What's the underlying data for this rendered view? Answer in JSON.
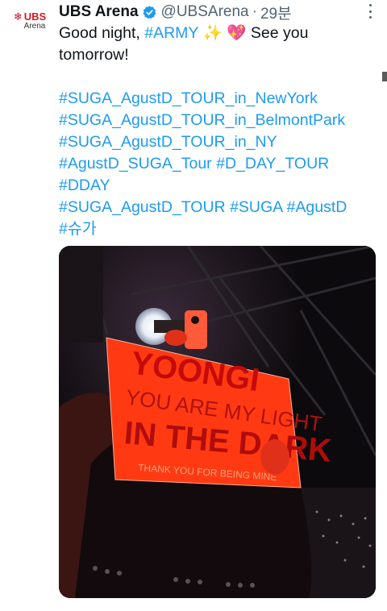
{
  "account": {
    "avatar_brand": "UBS",
    "avatar_sub": "Arena",
    "name": "UBS Arena",
    "handle": "@UBSArena",
    "separator": "·",
    "time": "29분"
  },
  "tweet": {
    "line1": {
      "text": "Good night, ",
      "hashtag": "#ARMY",
      "emoji": " ✨ 💖",
      "tail": " See you"
    },
    "line2": "tomorrow!",
    "hashtag_lines": [
      [
        "#SUGA_AgustD_TOUR_in_NewYork"
      ],
      [
        "#SUGA_AgustD_TOUR_in_BelmontPark"
      ],
      [
        "#SUGA_AgustD_TOUR_in_NY"
      ],
      [
        "#AgustD_SUGA_Tour",
        "#D_DAY_TOUR"
      ],
      [
        "#DDAY"
      ],
      [
        "#SUGA_AgustD_TOUR",
        "#SUGA",
        "#AgustD"
      ],
      [
        "#슈가"
      ]
    ]
  },
  "photo": {
    "sign_lines": [
      "YOONGI",
      "YOU ARE MY LIGHT",
      "IN THE DARK",
      "THANK YOU FOR BEING MINE"
    ]
  },
  "colors": {
    "link": "#1d9bf0",
    "text": "#0f1419",
    "muted": "#536471",
    "sign": "#ff3a12",
    "brand": "#d7191f"
  }
}
